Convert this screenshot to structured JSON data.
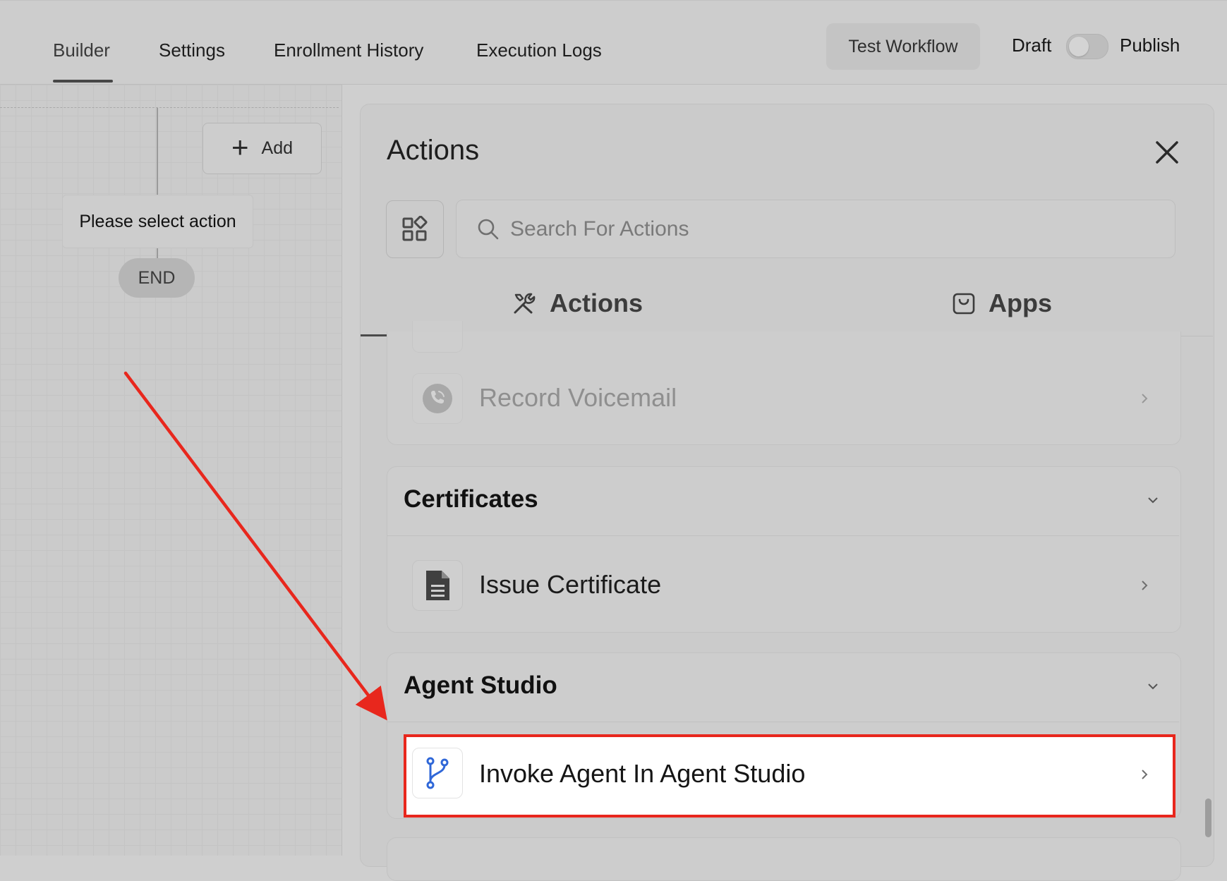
{
  "topbar": {
    "tabs": [
      {
        "label": "Builder",
        "active": true
      },
      {
        "label": "Settings",
        "active": false
      },
      {
        "label": "Enrollment History",
        "active": false
      },
      {
        "label": "Execution Logs",
        "active": false
      }
    ],
    "test_button": "Test Workflow",
    "draft_label": "Draft",
    "publish_label": "Publish",
    "publish_toggle_on": false
  },
  "canvas": {
    "add_button": "Add",
    "pending_node": "Please select action",
    "end_node": "END"
  },
  "panel": {
    "title": "Actions",
    "search": {
      "placeholder": "Search For Actions",
      "value": ""
    },
    "tabs": [
      {
        "label": "Actions",
        "icon": "tools-icon",
        "active": true
      },
      {
        "label": "Apps",
        "icon": "shopping-bag-icon",
        "active": false
      }
    ],
    "items": {
      "record_voicemail": {
        "label": "Record Voicemail",
        "icon": "voicemail-icon",
        "disabled": true
      },
      "certificates": {
        "title": "Certificates",
        "items": [
          {
            "label": "Issue Certificate",
            "icon": "document-icon"
          }
        ]
      },
      "agent_studio": {
        "title": "Agent Studio",
        "items": [
          {
            "label": "Invoke Agent In Agent Studio",
            "icon": "branch-icon",
            "highlighted": true
          }
        ]
      }
    }
  },
  "colors": {
    "highlight_border": "#e8271d",
    "annotation_arrow": "#e8271d",
    "branch_icon": "#2f67d8"
  }
}
